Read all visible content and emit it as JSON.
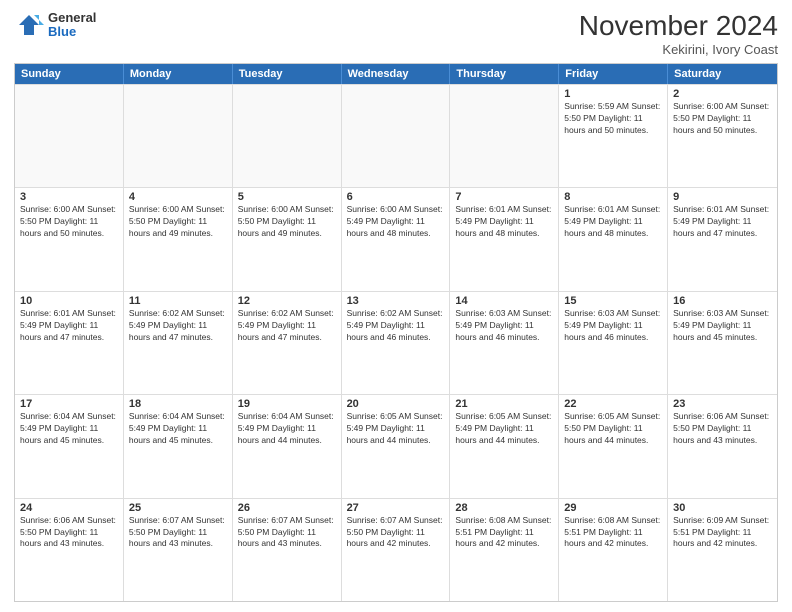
{
  "header": {
    "logo_general": "General",
    "logo_blue": "Blue",
    "month_title": "November 2024",
    "location": "Kekirini, Ivory Coast"
  },
  "weekdays": [
    "Sunday",
    "Monday",
    "Tuesday",
    "Wednesday",
    "Thursday",
    "Friday",
    "Saturday"
  ],
  "rows": [
    [
      {
        "day": "",
        "info": ""
      },
      {
        "day": "",
        "info": ""
      },
      {
        "day": "",
        "info": ""
      },
      {
        "day": "",
        "info": ""
      },
      {
        "day": "",
        "info": ""
      },
      {
        "day": "1",
        "info": "Sunrise: 5:59 AM\nSunset: 5:50 PM\nDaylight: 11 hours and 50 minutes."
      },
      {
        "day": "2",
        "info": "Sunrise: 6:00 AM\nSunset: 5:50 PM\nDaylight: 11 hours and 50 minutes."
      }
    ],
    [
      {
        "day": "3",
        "info": "Sunrise: 6:00 AM\nSunset: 5:50 PM\nDaylight: 11 hours and 50 minutes."
      },
      {
        "day": "4",
        "info": "Sunrise: 6:00 AM\nSunset: 5:50 PM\nDaylight: 11 hours and 49 minutes."
      },
      {
        "day": "5",
        "info": "Sunrise: 6:00 AM\nSunset: 5:50 PM\nDaylight: 11 hours and 49 minutes."
      },
      {
        "day": "6",
        "info": "Sunrise: 6:00 AM\nSunset: 5:49 PM\nDaylight: 11 hours and 48 minutes."
      },
      {
        "day": "7",
        "info": "Sunrise: 6:01 AM\nSunset: 5:49 PM\nDaylight: 11 hours and 48 minutes."
      },
      {
        "day": "8",
        "info": "Sunrise: 6:01 AM\nSunset: 5:49 PM\nDaylight: 11 hours and 48 minutes."
      },
      {
        "day": "9",
        "info": "Sunrise: 6:01 AM\nSunset: 5:49 PM\nDaylight: 11 hours and 47 minutes."
      }
    ],
    [
      {
        "day": "10",
        "info": "Sunrise: 6:01 AM\nSunset: 5:49 PM\nDaylight: 11 hours and 47 minutes."
      },
      {
        "day": "11",
        "info": "Sunrise: 6:02 AM\nSunset: 5:49 PM\nDaylight: 11 hours and 47 minutes."
      },
      {
        "day": "12",
        "info": "Sunrise: 6:02 AM\nSunset: 5:49 PM\nDaylight: 11 hours and 47 minutes."
      },
      {
        "day": "13",
        "info": "Sunrise: 6:02 AM\nSunset: 5:49 PM\nDaylight: 11 hours and 46 minutes."
      },
      {
        "day": "14",
        "info": "Sunrise: 6:03 AM\nSunset: 5:49 PM\nDaylight: 11 hours and 46 minutes."
      },
      {
        "day": "15",
        "info": "Sunrise: 6:03 AM\nSunset: 5:49 PM\nDaylight: 11 hours and 46 minutes."
      },
      {
        "day": "16",
        "info": "Sunrise: 6:03 AM\nSunset: 5:49 PM\nDaylight: 11 hours and 45 minutes."
      }
    ],
    [
      {
        "day": "17",
        "info": "Sunrise: 6:04 AM\nSunset: 5:49 PM\nDaylight: 11 hours and 45 minutes."
      },
      {
        "day": "18",
        "info": "Sunrise: 6:04 AM\nSunset: 5:49 PM\nDaylight: 11 hours and 45 minutes."
      },
      {
        "day": "19",
        "info": "Sunrise: 6:04 AM\nSunset: 5:49 PM\nDaylight: 11 hours and 44 minutes."
      },
      {
        "day": "20",
        "info": "Sunrise: 6:05 AM\nSunset: 5:49 PM\nDaylight: 11 hours and 44 minutes."
      },
      {
        "day": "21",
        "info": "Sunrise: 6:05 AM\nSunset: 5:49 PM\nDaylight: 11 hours and 44 minutes."
      },
      {
        "day": "22",
        "info": "Sunrise: 6:05 AM\nSunset: 5:50 PM\nDaylight: 11 hours and 44 minutes."
      },
      {
        "day": "23",
        "info": "Sunrise: 6:06 AM\nSunset: 5:50 PM\nDaylight: 11 hours and 43 minutes."
      }
    ],
    [
      {
        "day": "24",
        "info": "Sunrise: 6:06 AM\nSunset: 5:50 PM\nDaylight: 11 hours and 43 minutes."
      },
      {
        "day": "25",
        "info": "Sunrise: 6:07 AM\nSunset: 5:50 PM\nDaylight: 11 hours and 43 minutes."
      },
      {
        "day": "26",
        "info": "Sunrise: 6:07 AM\nSunset: 5:50 PM\nDaylight: 11 hours and 43 minutes."
      },
      {
        "day": "27",
        "info": "Sunrise: 6:07 AM\nSunset: 5:50 PM\nDaylight: 11 hours and 42 minutes."
      },
      {
        "day": "28",
        "info": "Sunrise: 6:08 AM\nSunset: 5:51 PM\nDaylight: 11 hours and 42 minutes."
      },
      {
        "day": "29",
        "info": "Sunrise: 6:08 AM\nSunset: 5:51 PM\nDaylight: 11 hours and 42 minutes."
      },
      {
        "day": "30",
        "info": "Sunrise: 6:09 AM\nSunset: 5:51 PM\nDaylight: 11 hours and 42 minutes."
      }
    ]
  ]
}
